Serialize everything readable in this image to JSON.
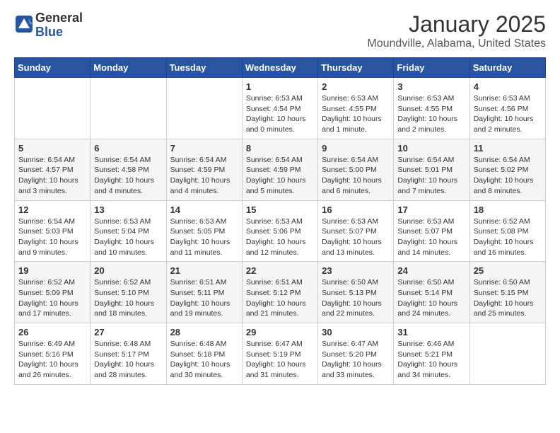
{
  "header": {
    "logo_line1": "General",
    "logo_line2": "Blue",
    "title": "January 2025",
    "subtitle": "Moundville, Alabama, United States"
  },
  "weekdays": [
    "Sunday",
    "Monday",
    "Tuesday",
    "Wednesday",
    "Thursday",
    "Friday",
    "Saturday"
  ],
  "weeks": [
    [
      {
        "day": "",
        "info": ""
      },
      {
        "day": "",
        "info": ""
      },
      {
        "day": "",
        "info": ""
      },
      {
        "day": "1",
        "info": "Sunrise: 6:53 AM\nSunset: 4:54 PM\nDaylight: 10 hours\nand 0 minutes."
      },
      {
        "day": "2",
        "info": "Sunrise: 6:53 AM\nSunset: 4:55 PM\nDaylight: 10 hours\nand 1 minute."
      },
      {
        "day": "3",
        "info": "Sunrise: 6:53 AM\nSunset: 4:55 PM\nDaylight: 10 hours\nand 2 minutes."
      },
      {
        "day": "4",
        "info": "Sunrise: 6:53 AM\nSunset: 4:56 PM\nDaylight: 10 hours\nand 2 minutes."
      }
    ],
    [
      {
        "day": "5",
        "info": "Sunrise: 6:54 AM\nSunset: 4:57 PM\nDaylight: 10 hours\nand 3 minutes."
      },
      {
        "day": "6",
        "info": "Sunrise: 6:54 AM\nSunset: 4:58 PM\nDaylight: 10 hours\nand 4 minutes."
      },
      {
        "day": "7",
        "info": "Sunrise: 6:54 AM\nSunset: 4:59 PM\nDaylight: 10 hours\nand 4 minutes."
      },
      {
        "day": "8",
        "info": "Sunrise: 6:54 AM\nSunset: 4:59 PM\nDaylight: 10 hours\nand 5 minutes."
      },
      {
        "day": "9",
        "info": "Sunrise: 6:54 AM\nSunset: 5:00 PM\nDaylight: 10 hours\nand 6 minutes."
      },
      {
        "day": "10",
        "info": "Sunrise: 6:54 AM\nSunset: 5:01 PM\nDaylight: 10 hours\nand 7 minutes."
      },
      {
        "day": "11",
        "info": "Sunrise: 6:54 AM\nSunset: 5:02 PM\nDaylight: 10 hours\nand 8 minutes."
      }
    ],
    [
      {
        "day": "12",
        "info": "Sunrise: 6:54 AM\nSunset: 5:03 PM\nDaylight: 10 hours\nand 9 minutes."
      },
      {
        "day": "13",
        "info": "Sunrise: 6:53 AM\nSunset: 5:04 PM\nDaylight: 10 hours\nand 10 minutes."
      },
      {
        "day": "14",
        "info": "Sunrise: 6:53 AM\nSunset: 5:05 PM\nDaylight: 10 hours\nand 11 minutes."
      },
      {
        "day": "15",
        "info": "Sunrise: 6:53 AM\nSunset: 5:06 PM\nDaylight: 10 hours\nand 12 minutes."
      },
      {
        "day": "16",
        "info": "Sunrise: 6:53 AM\nSunset: 5:07 PM\nDaylight: 10 hours\nand 13 minutes."
      },
      {
        "day": "17",
        "info": "Sunrise: 6:53 AM\nSunset: 5:07 PM\nDaylight: 10 hours\nand 14 minutes."
      },
      {
        "day": "18",
        "info": "Sunrise: 6:52 AM\nSunset: 5:08 PM\nDaylight: 10 hours\nand 16 minutes."
      }
    ],
    [
      {
        "day": "19",
        "info": "Sunrise: 6:52 AM\nSunset: 5:09 PM\nDaylight: 10 hours\nand 17 minutes."
      },
      {
        "day": "20",
        "info": "Sunrise: 6:52 AM\nSunset: 5:10 PM\nDaylight: 10 hours\nand 18 minutes."
      },
      {
        "day": "21",
        "info": "Sunrise: 6:51 AM\nSunset: 5:11 PM\nDaylight: 10 hours\nand 19 minutes."
      },
      {
        "day": "22",
        "info": "Sunrise: 6:51 AM\nSunset: 5:12 PM\nDaylight: 10 hours\nand 21 minutes."
      },
      {
        "day": "23",
        "info": "Sunrise: 6:50 AM\nSunset: 5:13 PM\nDaylight: 10 hours\nand 22 minutes."
      },
      {
        "day": "24",
        "info": "Sunrise: 6:50 AM\nSunset: 5:14 PM\nDaylight: 10 hours\nand 24 minutes."
      },
      {
        "day": "25",
        "info": "Sunrise: 6:50 AM\nSunset: 5:15 PM\nDaylight: 10 hours\nand 25 minutes."
      }
    ],
    [
      {
        "day": "26",
        "info": "Sunrise: 6:49 AM\nSunset: 5:16 PM\nDaylight: 10 hours\nand 26 minutes."
      },
      {
        "day": "27",
        "info": "Sunrise: 6:48 AM\nSunset: 5:17 PM\nDaylight: 10 hours\nand 28 minutes."
      },
      {
        "day": "28",
        "info": "Sunrise: 6:48 AM\nSunset: 5:18 PM\nDaylight: 10 hours\nand 30 minutes."
      },
      {
        "day": "29",
        "info": "Sunrise: 6:47 AM\nSunset: 5:19 PM\nDaylight: 10 hours\nand 31 minutes."
      },
      {
        "day": "30",
        "info": "Sunrise: 6:47 AM\nSunset: 5:20 PM\nDaylight: 10 hours\nand 33 minutes."
      },
      {
        "day": "31",
        "info": "Sunrise: 6:46 AM\nSunset: 5:21 PM\nDaylight: 10 hours\nand 34 minutes."
      },
      {
        "day": "",
        "info": ""
      }
    ]
  ]
}
